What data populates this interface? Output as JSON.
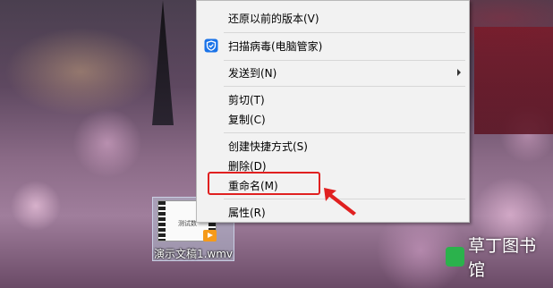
{
  "context_menu": {
    "items": [
      {
        "label": "还原以前的版本(V)"
      },
      {
        "label": "扫描病毒(电脑管家)",
        "icon": "shield-icon"
      },
      {
        "label": "发送到(N)",
        "submenu": true
      },
      {
        "label": "剪切(T)"
      },
      {
        "label": "复制(C)"
      },
      {
        "label": "创建快捷方式(S)"
      },
      {
        "label": "删除(D)"
      },
      {
        "label": "重命名(M)",
        "highlighted": true
      },
      {
        "label": "属性(R)"
      }
    ]
  },
  "desktop_file": {
    "name": "演示文稿1.wmv",
    "thumbnail_text": "测试数",
    "badge_icon": "play-icon"
  },
  "annotation": {
    "highlight_color": "#e02020",
    "pointer_icon": "red-arrow-icon"
  },
  "watermark": {
    "text": "草丁图书馆",
    "icon": "logo-icon"
  }
}
